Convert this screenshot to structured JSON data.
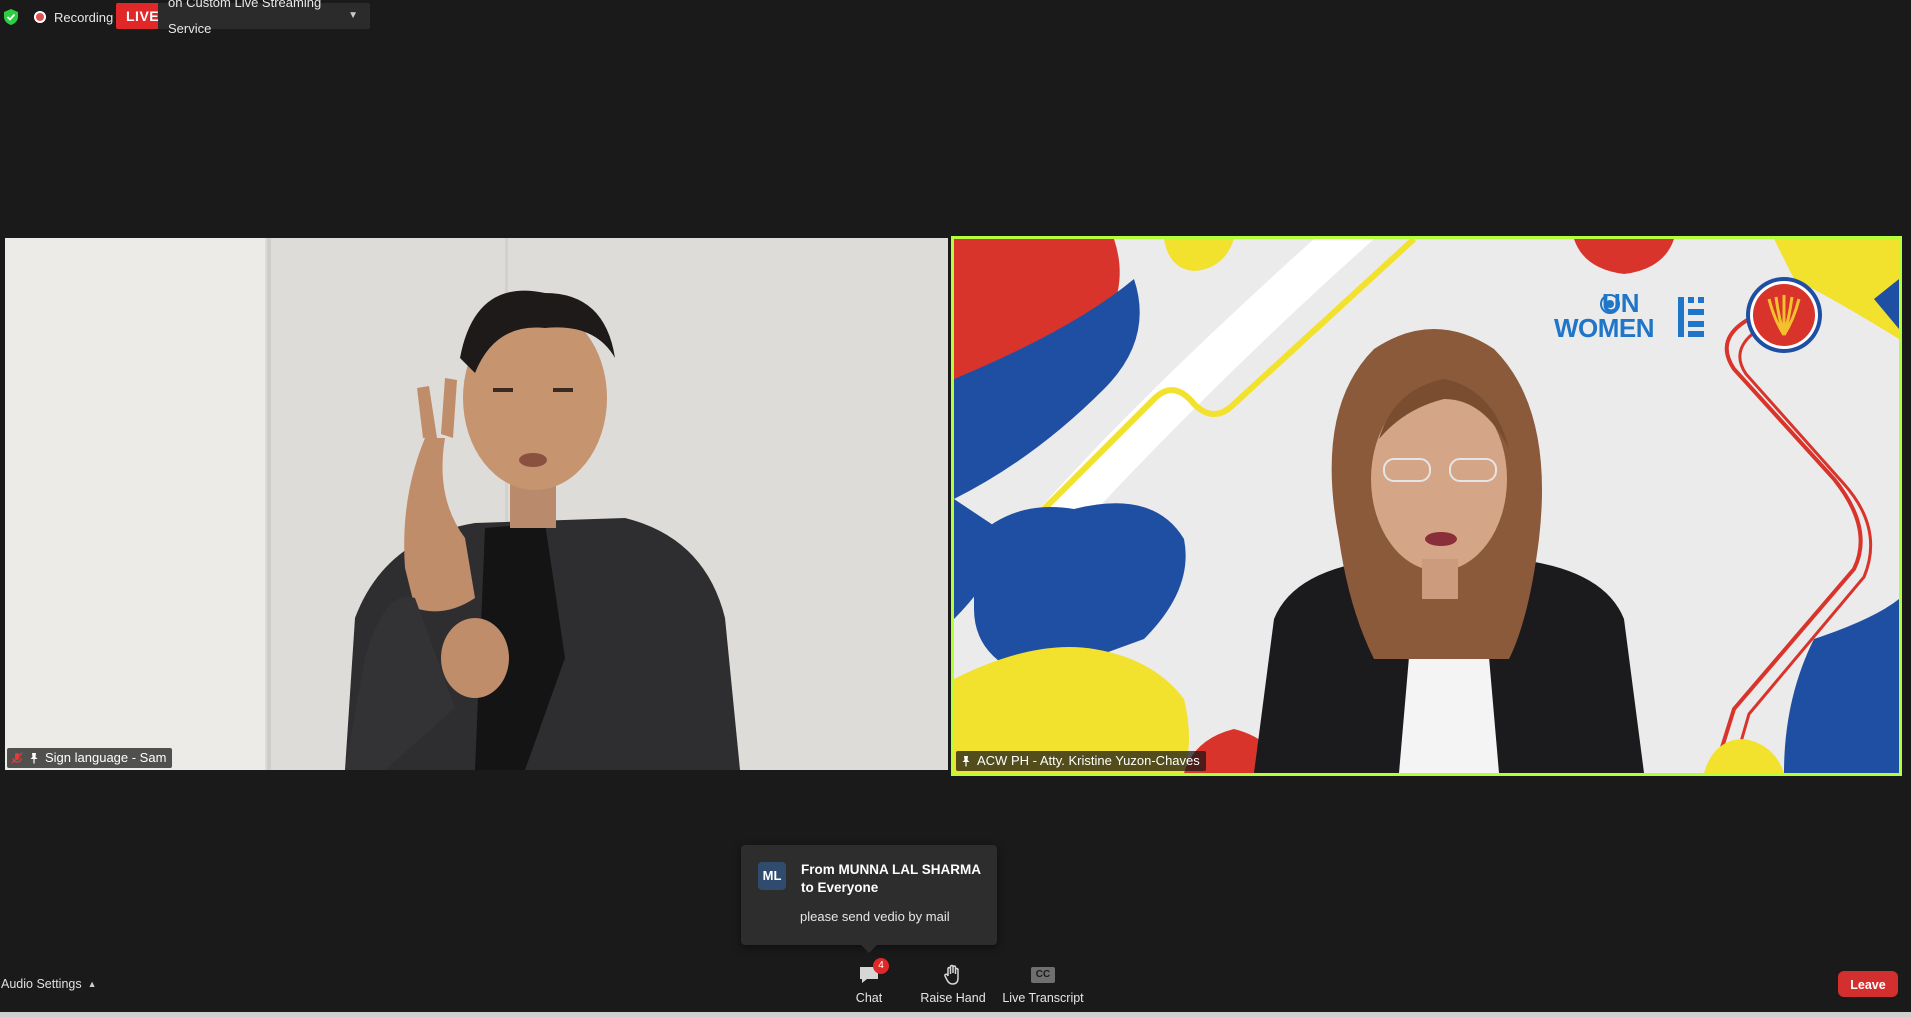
{
  "topbar": {
    "recording_label": "Recording",
    "live_label": "LIVE",
    "stream_service_label": "on Custom Live Streaming Service",
    "dropdown_icon": "caret-down-icon",
    "security_icon": "shield-check-icon",
    "fullscreen_icon": "fullscreen-icon"
  },
  "tiles": [
    {
      "name": "Sign language - Sam",
      "muted": true,
      "pinned": true,
      "active_speaker": false
    },
    {
      "name": "ACW PH - Atty. Kristine Yuzon-Chaves",
      "muted": false,
      "pinned": true,
      "active_speaker": true,
      "background_logos": {
        "un_women_line1": "UN",
        "un_women_line2": "WOMEN"
      }
    }
  ],
  "chat_toast": {
    "avatar_initials": "ML",
    "from": "From MUNNA LAL SHARMA to Everyone",
    "message": "please send vedio by mail"
  },
  "toolbar": {
    "audio_settings_label": "Audio Settings",
    "chat_label": "Chat",
    "chat_badge": "4",
    "raise_hand_label": "Raise Hand",
    "live_transcript_label": "Live Transcript",
    "cc_label": "CC",
    "leave_label": "Leave"
  },
  "colors": {
    "background": "#1a1a1a",
    "live_red": "#e02828",
    "active_speaker_border": "#b5ff3a",
    "leave_red": "#d32f2f",
    "avatar_blue": "#2f4b6e"
  }
}
